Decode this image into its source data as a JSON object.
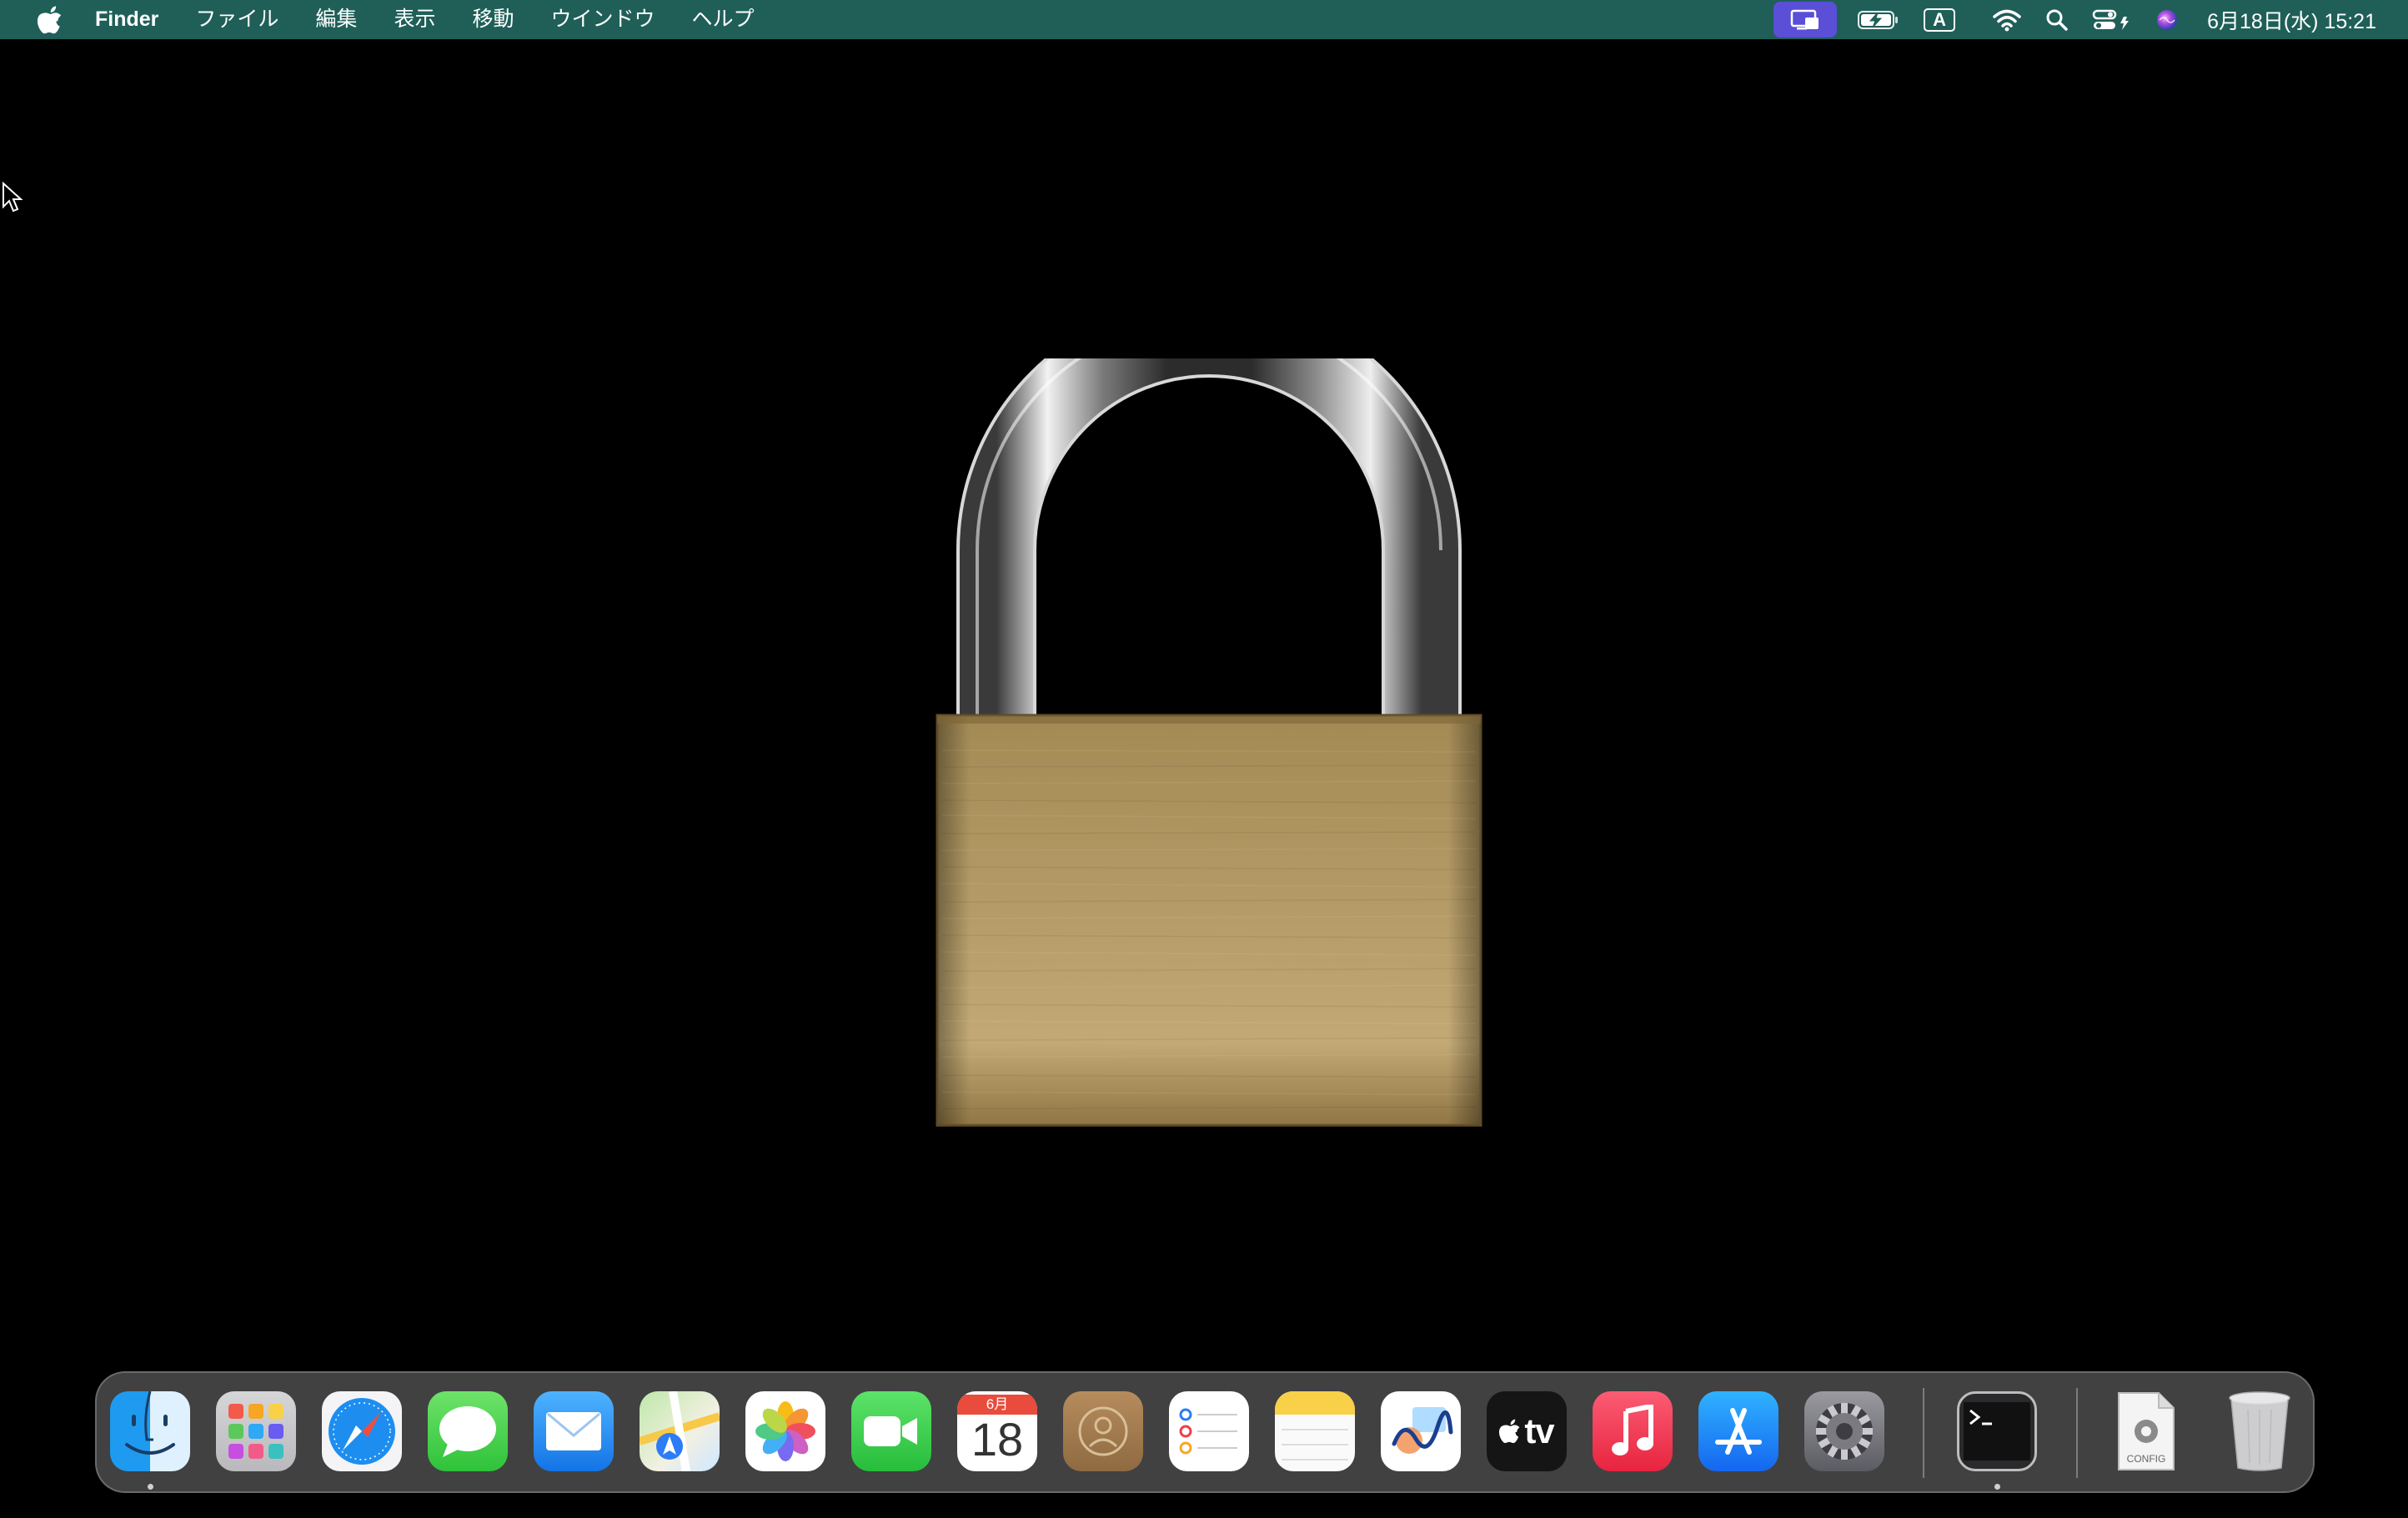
{
  "menubar": {
    "app_name": "Finder",
    "items": [
      "ファイル",
      "編集",
      "表示",
      "移動",
      "ウインドウ",
      "ヘルプ"
    ],
    "input_mode": "A",
    "clock": "6月18日(水)  15:21"
  },
  "dock": {
    "apps": [
      {
        "name": "Finder",
        "running": true
      },
      {
        "name": "Launchpad"
      },
      {
        "name": "Safari"
      },
      {
        "name": "Messages"
      },
      {
        "name": "Mail"
      },
      {
        "name": "Maps"
      },
      {
        "name": "Photos"
      },
      {
        "name": "FaceTime"
      },
      {
        "name": "Calendar"
      },
      {
        "name": "Contacts"
      },
      {
        "name": "Reminders"
      },
      {
        "name": "Notes"
      },
      {
        "name": "Freeform"
      },
      {
        "name": "TV"
      },
      {
        "name": "Music"
      },
      {
        "name": "App Store"
      },
      {
        "name": "System Settings"
      },
      {
        "name": "Terminal",
        "running": true
      },
      {
        "name": "Config file"
      },
      {
        "name": "Trash"
      }
    ],
    "calendar": {
      "month": "6月",
      "day": "18"
    },
    "tv_label": "tv",
    "config_label": "CONFIG"
  },
  "colors": {
    "menubar_bg": "#1f5f58",
    "desktop_bg": "#000000",
    "screen_mirror_bg": "#5a4fd6"
  }
}
